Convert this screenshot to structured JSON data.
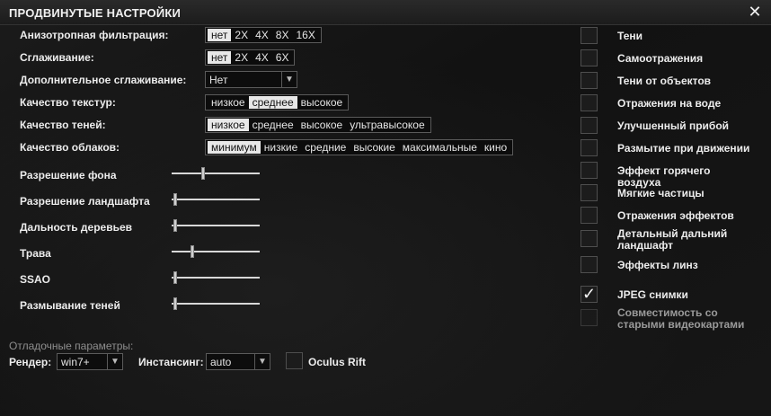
{
  "window": {
    "title": "ПРОДВИНУТЫЕ НАСТРОЙКИ",
    "close_icon": "close-icon"
  },
  "left": {
    "anisotropic": {
      "label": "Анизотропная фильтрация:",
      "options": [
        "нет",
        "2X",
        "4X",
        "8X",
        "16X"
      ],
      "selected": 0
    },
    "antialiasing": {
      "label": "Сглаживание:",
      "options": [
        "нет",
        "2X",
        "4X",
        "6X"
      ],
      "selected": 0
    },
    "extra_aa": {
      "label": "Дополнительное сглаживание:",
      "value": "Нет"
    },
    "texture_quality": {
      "label": "Качество текстур:",
      "options": [
        "низкое",
        "среднее",
        "высокое"
      ],
      "selected": 1
    },
    "shadow_quality": {
      "label": "Качество теней:",
      "options": [
        "низкое",
        "среднее",
        "высокое",
        "ультравысокое"
      ],
      "selected": 0
    },
    "cloud_quality": {
      "label": "Качество облаков:",
      "options": [
        "минимум",
        "низкие",
        "средние",
        "высокие",
        "максимальные",
        "кино"
      ],
      "selected": 0
    },
    "sliders": [
      {
        "label": "Разрешение фона",
        "value": 0.35
      },
      {
        "label": "Разрешение ландшафта",
        "value": 0.02
      },
      {
        "label": "Дальность деревьев",
        "value": 0.02
      },
      {
        "label": "Трава",
        "value": 0.22
      },
      {
        "label": "SSAO",
        "value": 0.02
      },
      {
        "label": "Размывание теней",
        "value": 0.02
      }
    ]
  },
  "right": {
    "checkboxes": [
      {
        "label": "Тени",
        "checked": false
      },
      {
        "label": "Самоотражения",
        "checked": false
      },
      {
        "label": "Тени от объектов",
        "checked": false
      },
      {
        "label": "Отражения на воде",
        "checked": false
      },
      {
        "label": "Улучшенный прибой",
        "checked": false
      },
      {
        "label": "Размытие при движении",
        "checked": false
      },
      {
        "label": "Эффект горячего воздуха",
        "checked": false
      },
      {
        "label": "Мягкие частицы",
        "checked": false
      },
      {
        "label": "Отражения эффектов",
        "checked": false
      },
      {
        "label": "Детальный дальний ландшафт",
        "checked": false
      },
      {
        "label": "Эффекты линз",
        "checked": false
      },
      {
        "label": "JPEG снимки",
        "checked": true
      },
      {
        "label": "Совместимость со старыми видеокартами",
        "checked": false,
        "disabled": true
      }
    ]
  },
  "debug": {
    "section_label": "Отладочные параметры:",
    "renderer_label": "Рендер:",
    "renderer_value": "win7+",
    "instancing_label": "Инстансинг:",
    "instancing_value": "auto",
    "oculus_label": "Oculus Rift",
    "oculus_checked": false
  },
  "colors": {
    "background": "#141414",
    "selected_option": "#e8e8e8",
    "border": "#5a5a5a",
    "disabled_text": "#9a9a9a"
  }
}
